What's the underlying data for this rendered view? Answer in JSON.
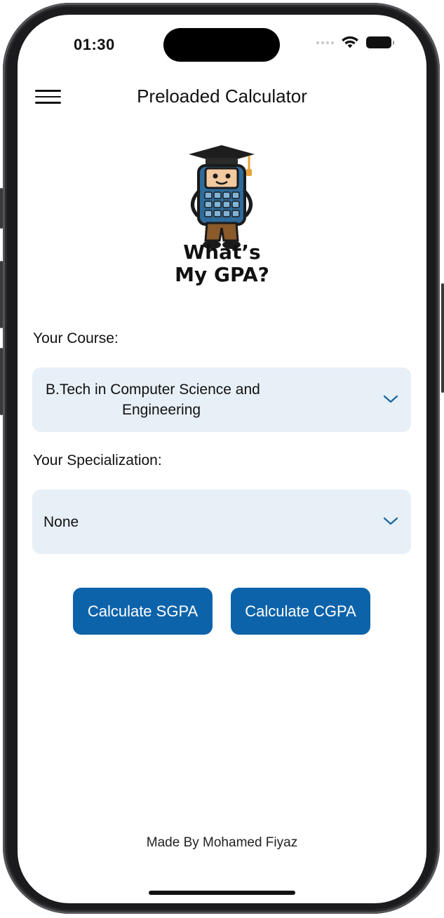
{
  "status_bar": {
    "time": "01:30",
    "signal_icon": "signal-dots-icon",
    "wifi_icon": "wifi-icon",
    "battery_icon": "battery-icon"
  },
  "nav": {
    "menu_icon": "hamburger-menu-icon",
    "title": "Preloaded Calculator"
  },
  "logo": {
    "icon": "graduate-calculator-mascot",
    "line1": "What’s",
    "line2": "My GPA?"
  },
  "course": {
    "label": "Your Course:",
    "value_line1": "B.Tech in Computer Science and",
    "value_line2": "Engineering"
  },
  "specialization": {
    "label": "Your Specialization:",
    "value": "None"
  },
  "actions": {
    "sgpa_label": "Calculate SGPA",
    "cgpa_label": "Calculate CGPA"
  },
  "footer": {
    "credit": "Made By Mohamed Fiyaz"
  },
  "colors": {
    "accent": "#0d63aa",
    "dropdown_bg": "#e7f0f7",
    "chevron": "#1f6aa6"
  }
}
